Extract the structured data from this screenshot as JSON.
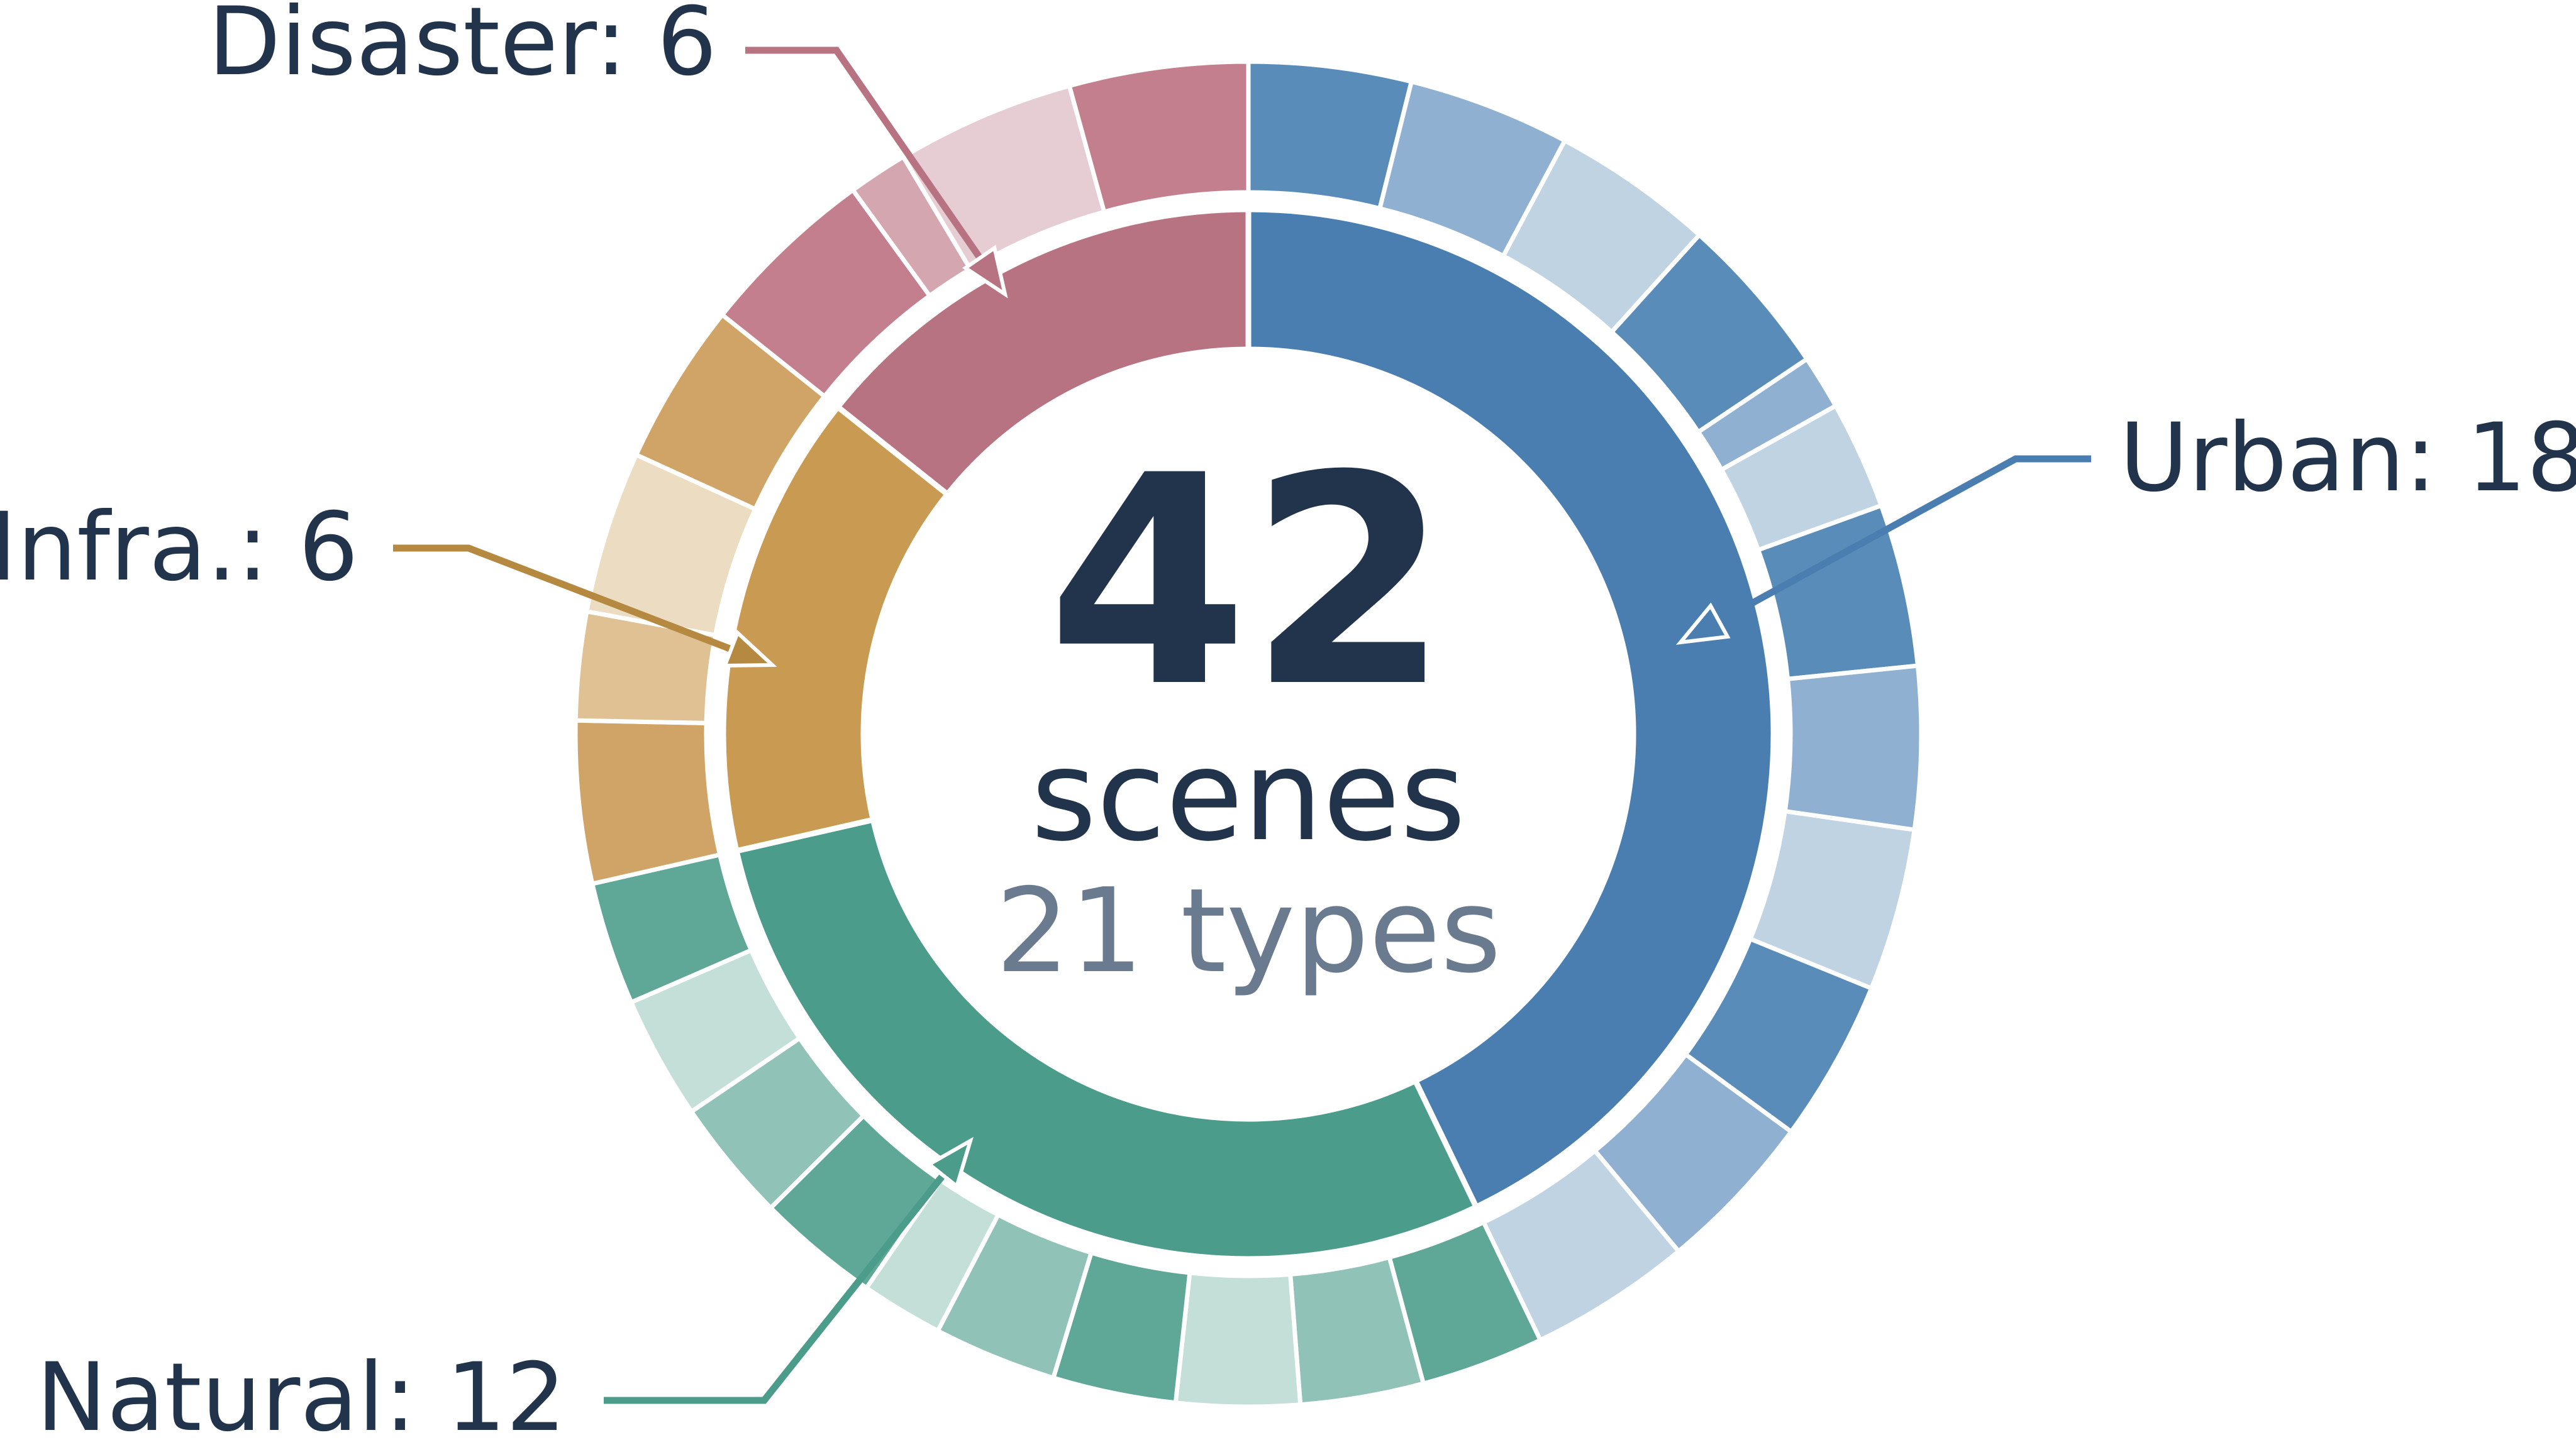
{
  "chart_data": {
    "type": "pie",
    "style": "nested-donut",
    "center": {
      "count": "42",
      "unit": "scenes",
      "subtitle": "21 types"
    },
    "categories": [
      {
        "name": "Urban",
        "label": "Urban: 18",
        "value": 18,
        "color": "#4a7eb0",
        "subcategories": [
          3,
          3,
          3,
          3,
          1,
          2,
          3,
          3,
          3,
          3,
          3,
          3
        ],
        "sub_colors": [
          "#5a8cba",
          "#8fb0d1",
          "#c0d3e3"
        ]
      },
      {
        "name": "Natural",
        "label": "Natural: 12",
        "value": 12,
        "color": "#4c9c8b",
        "subcategories": [
          3,
          3,
          3,
          3,
          3,
          2,
          3,
          3,
          3,
          3
        ],
        "sub_colors": [
          "#5fa796",
          "#91c2b7",
          "#c3dfd8"
        ]
      },
      {
        "name": "Infra.",
        "label": "Infra.: 6",
        "value": 6,
        "color": "#c99a52",
        "subcategories": [
          3,
          2,
          3,
          3
        ],
        "sub_colors": [
          "#cfa466",
          "#dfc194",
          "#ecdcc2"
        ]
      },
      {
        "name": "Disaster",
        "label": "Disaster: 6",
        "value": 6,
        "color": "#b87382",
        "subcategories": [
          3,
          1,
          3,
          3
        ],
        "sub_colors": [
          "#c47f8e",
          "#d4a6b0",
          "#e6cdd3"
        ]
      }
    ],
    "legend": "callout labels with arrows"
  },
  "palette": {
    "text": "#22344b",
    "subtext": "#6a7a8f",
    "background": "#ffffff"
  }
}
